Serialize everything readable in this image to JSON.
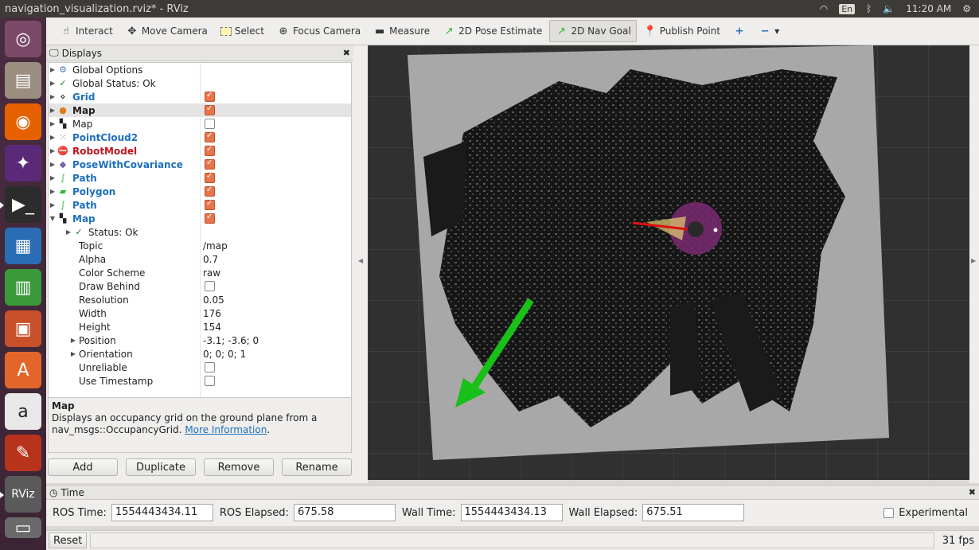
{
  "window": {
    "title": "navigation_visualization.rviz* - RViz"
  },
  "tray": {
    "lang": "En",
    "clock": "11:20 AM"
  },
  "toolbar": {
    "interact": "Interact",
    "move_camera": "Move Camera",
    "select": "Select",
    "focus_camera": "Focus Camera",
    "measure": "Measure",
    "pose_estimate": "2D Pose Estimate",
    "nav_goal": "2D Nav Goal",
    "publish_point": "Publish Point"
  },
  "displays": {
    "title": "Displays",
    "items": [
      {
        "label": "Global Options"
      },
      {
        "label": "Global Status: Ok"
      },
      {
        "label": "Grid",
        "checked": true
      },
      {
        "label": "Map",
        "checked": true
      },
      {
        "label": "Map",
        "checked": false
      },
      {
        "label": "PointCloud2",
        "checked": true
      },
      {
        "label": "RobotModel",
        "checked": true
      },
      {
        "label": "PoseWithCovariance",
        "checked": true
      },
      {
        "label": "Path",
        "checked": true
      },
      {
        "label": "Polygon",
        "checked": true
      },
      {
        "label": "Path",
        "checked": true
      },
      {
        "label": "Map",
        "checked": true
      }
    ],
    "props": [
      {
        "label": "Status: Ok",
        "value": ""
      },
      {
        "label": "Topic",
        "value": "/map"
      },
      {
        "label": "Alpha",
        "value": "0.7"
      },
      {
        "label": "Color Scheme",
        "value": "raw"
      },
      {
        "label": "Draw Behind",
        "value": ""
      },
      {
        "label": "Resolution",
        "value": "0.05"
      },
      {
        "label": "Width",
        "value": "176"
      },
      {
        "label": "Height",
        "value": "154"
      },
      {
        "label": "Position",
        "value": "-3.1; -3.6; 0"
      },
      {
        "label": "Orientation",
        "value": "0; 0; 0; 1"
      },
      {
        "label": "Unreliable",
        "value": ""
      },
      {
        "label": "Use Timestamp",
        "value": ""
      }
    ],
    "description": {
      "title": "Map",
      "text": "Displays an occupancy grid on the ground plane from a nav_msgs::OccupancyGrid.",
      "link": "More Information"
    },
    "buttons": {
      "add": "Add",
      "duplicate": "Duplicate",
      "remove": "Remove",
      "rename": "Rename"
    }
  },
  "time": {
    "title": "Time",
    "ros_time_label": "ROS Time:",
    "ros_time": "1554443434.11",
    "ros_elapsed_label": "ROS Elapsed:",
    "ros_elapsed": "675.58",
    "wall_time_label": "Wall Time:",
    "wall_time": "1554443434.13",
    "wall_elapsed_label": "Wall Elapsed:",
    "wall_elapsed": "675.51",
    "experimental": "Experimental"
  },
  "status": {
    "reset": "Reset",
    "fps": "31 fps"
  }
}
